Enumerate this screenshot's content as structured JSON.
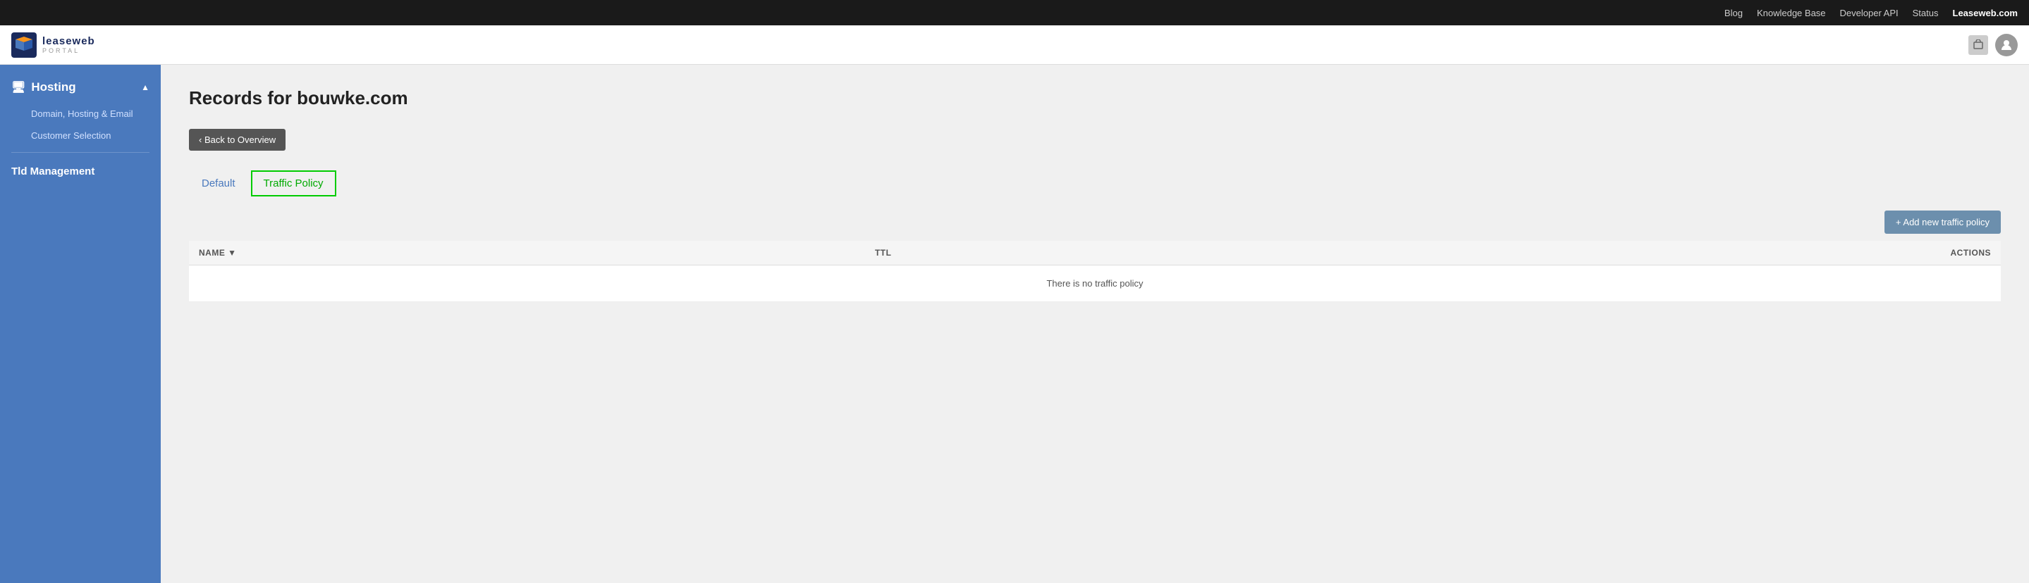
{
  "topnav": {
    "items": [
      {
        "label": "Blog",
        "bold": false
      },
      {
        "label": "Knowledge Base",
        "bold": false
      },
      {
        "label": "Developer API",
        "bold": false
      },
      {
        "label": "Status",
        "bold": false
      },
      {
        "label": "Leaseweb.com",
        "bold": true
      }
    ]
  },
  "header": {
    "logo_text": "leaseweb",
    "logo_sub": "PORTAL"
  },
  "sidebar": {
    "hosting_label": "Hosting",
    "sub_items": [
      {
        "label": "Domain, Hosting & Email",
        "active": false
      },
      {
        "label": "Customer Selection",
        "active": false
      }
    ],
    "tld_label": "Tld Management"
  },
  "main": {
    "page_title": "Records for bouwke.com",
    "back_button": "‹ Back to Overview",
    "tabs": [
      {
        "label": "Default",
        "active": false
      },
      {
        "label": "Traffic Policy",
        "active": true
      }
    ],
    "add_button": "+ Add new traffic policy",
    "table": {
      "columns": [
        {
          "label": "NAME ▼"
        },
        {
          "label": "TTL"
        },
        {
          "label": "ACTIONS"
        }
      ],
      "empty_message": "There is no traffic policy"
    }
  }
}
